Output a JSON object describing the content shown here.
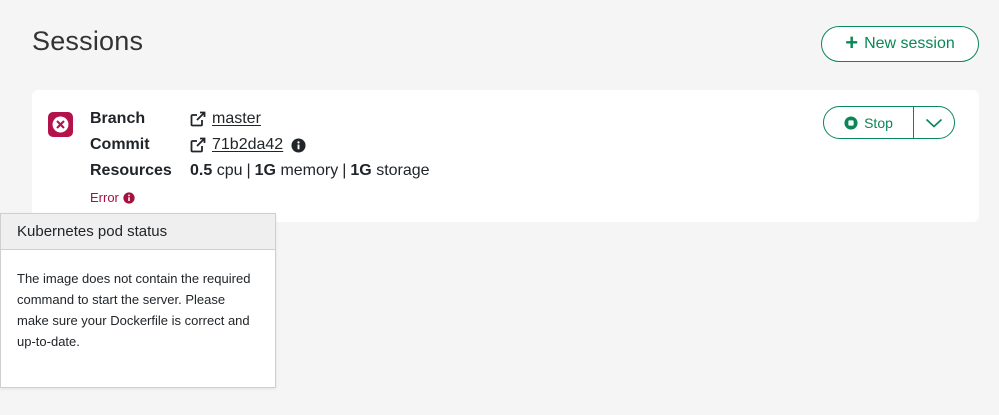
{
  "header": {
    "title": "Sessions",
    "new_session_label": "New session"
  },
  "session": {
    "status_icon": "x-circle-icon",
    "branch": {
      "label": "Branch",
      "value": "master"
    },
    "commit": {
      "label": "Commit",
      "value": "71b2da42"
    },
    "resources": {
      "label": "Resources",
      "cpu_value": "0.5",
      "cpu_unit": "cpu",
      "memory_value": "1G",
      "memory_unit": "memory",
      "storage_value": "1G",
      "storage_unit": "storage",
      "separator": "|"
    },
    "error_label": "Error",
    "actions": {
      "stop_label": "Stop"
    }
  },
  "popover": {
    "title": "Kubernetes pod status",
    "body": "The image does not contain the required command to start the server. Please make sure your Dockerfile is correct and up-to-date."
  },
  "colors": {
    "accent": "#0a8758",
    "error": "#b3124a",
    "background": "#f5f5f6"
  }
}
